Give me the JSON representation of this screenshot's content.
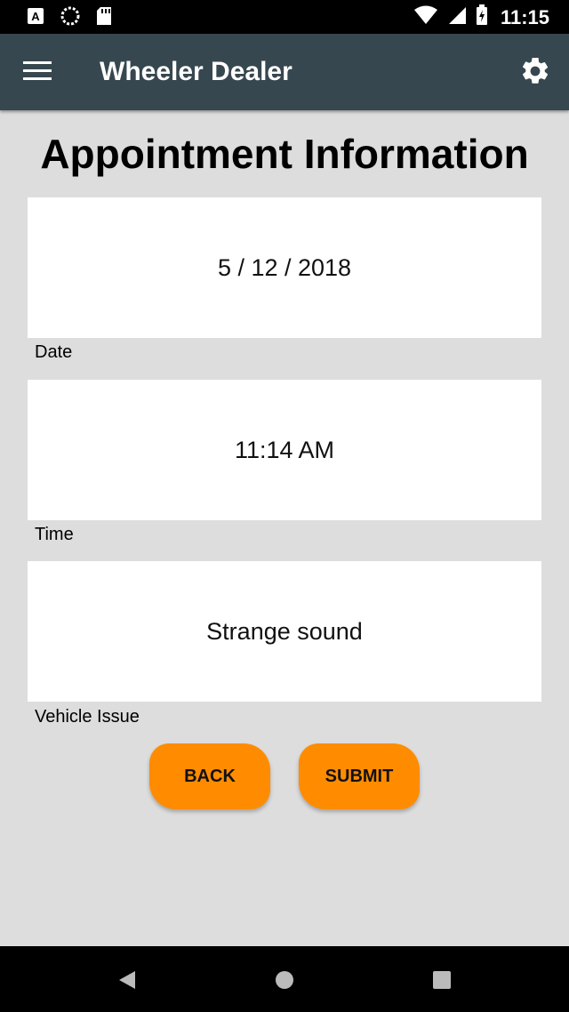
{
  "status_bar": {
    "time": "11:15",
    "icons": [
      "text-a-icon",
      "loading-circle-icon",
      "sd-card-icon",
      "location-icon",
      "wifi-icon",
      "cell-signal-icon",
      "battery-icon"
    ]
  },
  "app_bar": {
    "title": "Wheeler Dealer",
    "menu_icon": "hamburger-menu-icon",
    "settings_icon": "gear-icon"
  },
  "main": {
    "title": "Appointment Information",
    "fields": [
      {
        "value": "5 / 12 / 2018",
        "label": "Date"
      },
      {
        "value": "11:14 AM",
        "label": "Time"
      },
      {
        "value": "Strange sound",
        "label": "Vehicle Issue"
      }
    ],
    "buttons": {
      "back_label": "BACK",
      "submit_label": "SUBMIT"
    }
  },
  "nav_bar": {
    "icons": [
      "back-triangle-icon",
      "home-circle-icon",
      "recents-square-icon"
    ]
  },
  "colors": {
    "app_bar": "#37474f",
    "background": "#dddddd",
    "button": "#ff8c00"
  }
}
